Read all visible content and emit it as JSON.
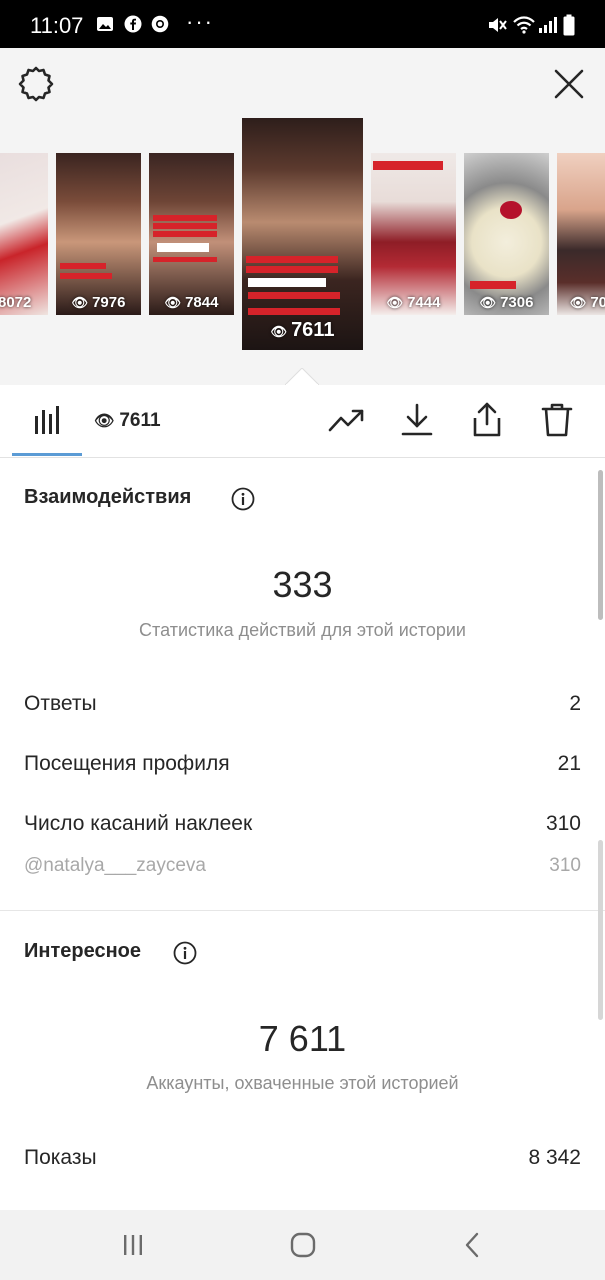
{
  "status_bar": {
    "time": "11:07",
    "dots": "···"
  },
  "stories": [
    {
      "views": "8072"
    },
    {
      "views": "7976"
    },
    {
      "views": "7844"
    },
    {
      "views": "7611",
      "selected": true
    },
    {
      "views": "7444"
    },
    {
      "views": "7306"
    },
    {
      "views": "70"
    }
  ],
  "tabs": {
    "views_count": "7611",
    "eye_glyph": "👁"
  },
  "interactions": {
    "heading": "Взаимодействия",
    "total": "333",
    "caption": "Статистика действий для этой истории",
    "rows": [
      {
        "label": "Ответы",
        "value": "2"
      },
      {
        "label": "Посещения профиля",
        "value": "21"
      },
      {
        "label": "Число касаний наклеек",
        "value": "310"
      }
    ],
    "sub_row": {
      "label": "@natalya___zayceva",
      "value": "310"
    }
  },
  "discovery": {
    "heading": "Интересное",
    "total": "7 611",
    "caption": "Аккаунты, охваченные этой историей",
    "rows": [
      {
        "label": "Показы",
        "value": "8 342"
      }
    ]
  },
  "colors": {
    "accent_tab": "#5b9bd5",
    "muted_text": "#8e8e8e"
  }
}
